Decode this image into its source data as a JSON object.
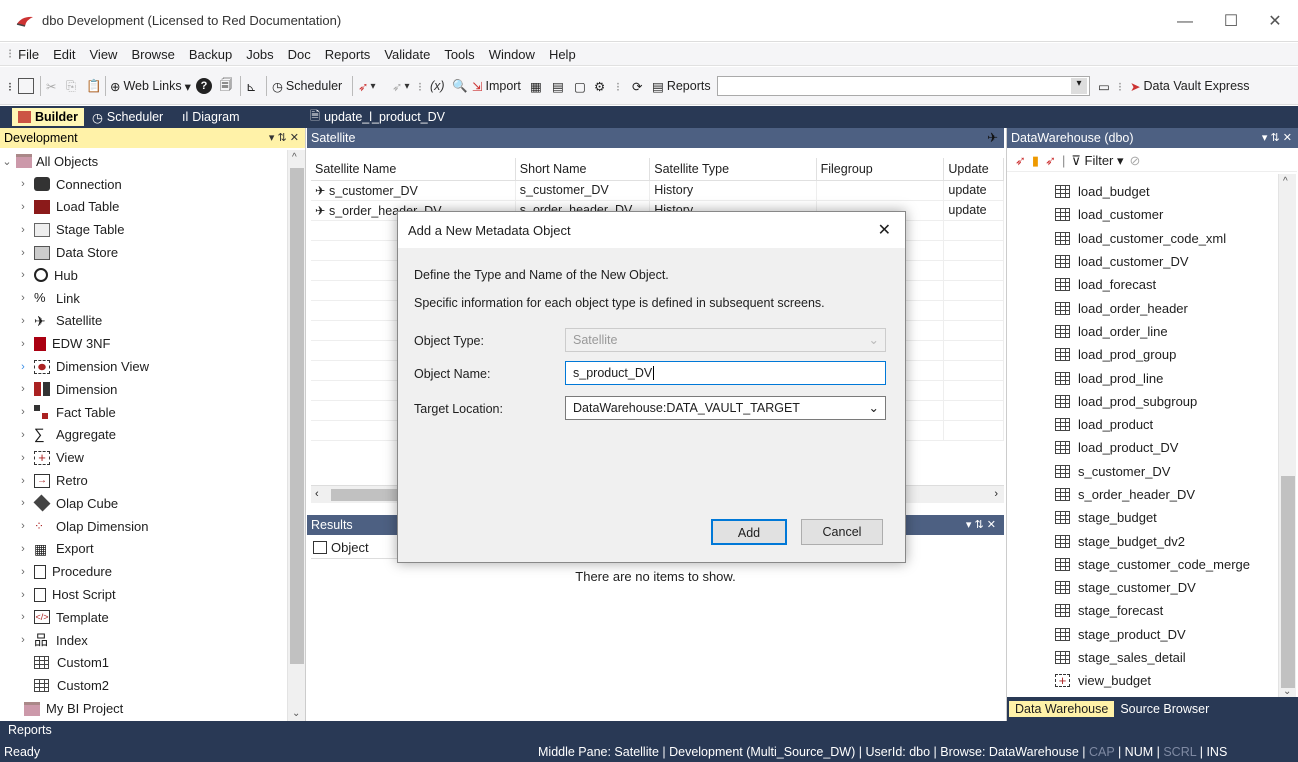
{
  "window": {
    "title": "dbo  Development (Licensed to Red Documentation)",
    "min": "—",
    "max": "☐",
    "close": "✕"
  },
  "menu": [
    "File",
    "Edit",
    "View",
    "Browse",
    "Backup",
    "Jobs",
    "Doc",
    "Reports",
    "Validate",
    "Tools",
    "Window",
    "Help"
  ],
  "toolbar": {
    "weblinks": "Web Links",
    "scheduler": "Scheduler",
    "import": "Import",
    "reports": "Reports",
    "dve": "Data Vault Express"
  },
  "tabs": {
    "builder": "Builder",
    "scheduler": "Scheduler",
    "diagram": "Diagram",
    "doc_tab": "update_l_product_DV"
  },
  "left": {
    "header": "Development",
    "pin": "▾ ⇅ ✕",
    "items": [
      "All Objects",
      "Connection",
      "Load Table",
      "Stage Table",
      "Data Store",
      "Hub",
      "Link",
      "Satellite",
      "EDW 3NF",
      "Dimension View",
      "Dimension",
      "Fact Table",
      "Aggregate",
      "View",
      "Retro",
      "Olap Cube",
      "Olap Dimension",
      "Export",
      "Procedure",
      "Host Script",
      "Template",
      "Index",
      "Custom1",
      "Custom2",
      "My BI Project"
    ]
  },
  "middle": {
    "header": "Satellite",
    "columns": [
      "Satellite Name",
      "Short Name",
      "Satellite Type",
      "Filegroup",
      "Update"
    ],
    "rows": [
      [
        "s_customer_DV",
        "s_customer_DV",
        "History",
        "",
        "update"
      ],
      [
        "s_order_header_DV",
        "s_order_header_DV",
        "History",
        "",
        "update"
      ]
    ],
    "results_header": "Results",
    "results_col": "Object",
    "empty": "There are no items to show."
  },
  "right": {
    "header": "DataWarehouse (dbo)",
    "filter": "Filter",
    "items": [
      "load_budget",
      "load_customer",
      "load_customer_code_xml",
      "load_customer_DV",
      "load_forecast",
      "load_order_header",
      "load_order_line",
      "load_prod_group",
      "load_prod_line",
      "load_prod_subgroup",
      "load_product",
      "load_product_DV",
      "s_customer_DV",
      "s_order_header_DV",
      "stage_budget",
      "stage_budget_dv2",
      "stage_customer_code_merge",
      "stage_customer_DV",
      "stage_forecast",
      "stage_product_DV",
      "stage_sales_detail",
      "view_budget"
    ],
    "tab1": "Data Warehouse",
    "tab2": "Source Browser"
  },
  "dialog": {
    "title": "Add a New Metadata Object",
    "line1": "Define the Type and Name of the New Object.",
    "line2": "Specific information for each object type is defined in subsequent screens.",
    "type_label": "Object Type:",
    "type_value": "Satellite",
    "name_label": "Object Name:",
    "name_value": "s_product_DV",
    "loc_label": "Target Location:",
    "loc_value": "DataWarehouse:DATA_VAULT_TARGET",
    "add": "Add",
    "cancel": "Cancel"
  },
  "bottom": {
    "reports_tab": "Reports",
    "ready": "Ready",
    "status": "Middle Pane: Satellite | Development (Multi_Source_DW) | UserId: dbo | Browse: DataWarehouse |",
    "cap": "CAP",
    "num": "NUM",
    "scrl": "SCRL",
    "ins": "INS"
  },
  "colors": {
    "dark": "#293955",
    "yellow": "#fff2a8",
    "blue": "#4d6082"
  }
}
